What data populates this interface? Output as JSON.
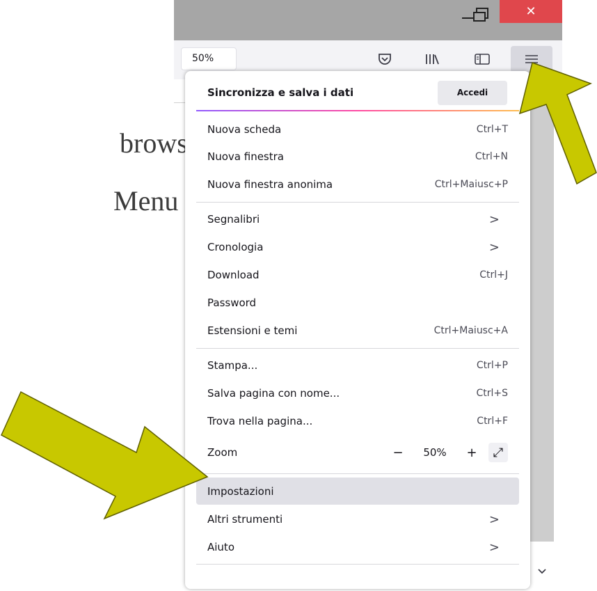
{
  "slide": {
    "line1": "browser,",
    "line2": "Menu and"
  },
  "window": {
    "close_glyph": "✕"
  },
  "toolbar": {
    "zoom_label": "50%",
    "icons": [
      "pocket-icon",
      "library-icon",
      "sidebar-icon",
      "hamburger-menu-icon"
    ]
  },
  "menu": {
    "sync_label": "Sincronizza e salva i dati",
    "signin_label": "Accedi",
    "items": [
      {
        "label": "Nuova scheda",
        "accel": "Ctrl+T"
      },
      {
        "label": "Nuova finestra",
        "accel": "Ctrl+N"
      },
      {
        "label": "Nuova finestra anonima",
        "accel": "Ctrl+Maiusc+P"
      },
      {
        "label": "Segnalibri",
        "accel": ">"
      },
      {
        "label": "Cronologia",
        "accel": ">"
      },
      {
        "label": "Download",
        "accel": "Ctrl+J"
      },
      {
        "label": "Password",
        "accel": ""
      },
      {
        "label": "Estensioni e temi",
        "accel": "Ctrl+Maiusc+A"
      },
      {
        "label": "Stampa...",
        "accel": "Ctrl+P"
      },
      {
        "label": "Salva pagina con nome...",
        "accel": "Ctrl+S"
      },
      {
        "label": "Trova nella pagina...",
        "accel": "Ctrl+F"
      },
      {
        "label": "Zoom",
        "accel": ""
      },
      {
        "label": "Impostazioni",
        "accel": ""
      },
      {
        "label": "Altri strumenti",
        "accel": ">"
      },
      {
        "label": "Aiuto",
        "accel": ">"
      }
    ],
    "zoom": {
      "minus": "−",
      "value": "50%",
      "plus": "+",
      "fullscreen": "⤢"
    },
    "highlighted_item": "Impostazioni"
  },
  "colors": {
    "arrow_fill": "#c8c800",
    "close_button": "#e0474c",
    "titlebar": "#a6a6a6",
    "highlight": "#e0e0e6"
  }
}
